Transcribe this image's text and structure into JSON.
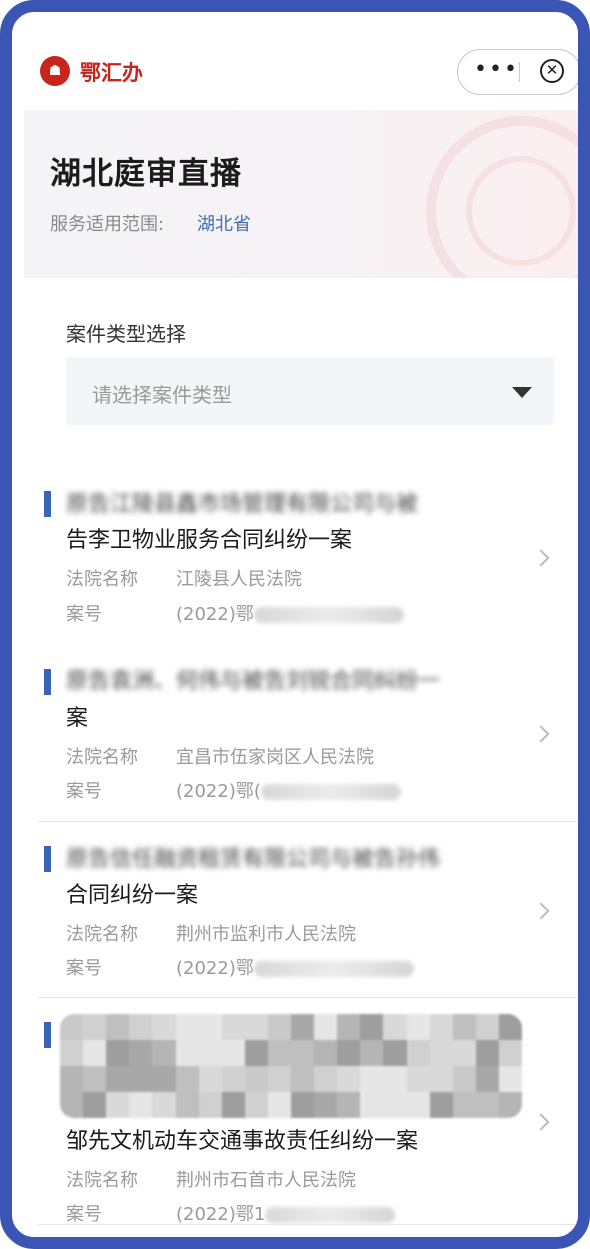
{
  "appbar": {
    "brand": "鄂汇办",
    "logo_glyph": "☗",
    "more_glyph": "•••",
    "close_glyph": "✕"
  },
  "header": {
    "title": "湖北庭审直播",
    "scope_label": "服务适用范围:",
    "scope_value": "湖北省"
  },
  "filter": {
    "label": "案件类型选择",
    "placeholder": "请选择案件类型"
  },
  "cases": [
    {
      "title_line1": "原告江陵县鑫市场管理有限公司与被",
      "title_line2": "告李卫物业服务合同纠纷一案",
      "court_key": "法院名称",
      "court": "江陵县人民法院",
      "case_key": "案号",
      "case_no": "(2022)鄂"
    },
    {
      "title_line1": "原告袁洲、何伟与被告刘锐合同纠纷一",
      "title_line2": "案",
      "court_key": "法院名称",
      "court": "宜昌市伍家岗区人民法院",
      "case_key": "案号",
      "case_no": "(2022)鄂("
    },
    {
      "title_line1": "原告信任融资租赁有限公司与被告孙伟",
      "title_line2": "合同纠纷一案",
      "court_key": "法院名称",
      "court": "荆州市监利市人民法院",
      "case_key": "案号",
      "case_no": "(2022)鄂"
    },
    {
      "title_line2": "邹先文机动车交通事故责任纠纷一案",
      "court_key": "法院名称",
      "court": "荆州市石首市人民法院",
      "case_key": "案号",
      "case_no": "(2022)鄂1"
    }
  ],
  "colors": {
    "brand_red": "#c7241c",
    "accent_blue": "#3b63b5",
    "frame_blue": "#3a55b3",
    "scope_blue": "#3d6fb6"
  }
}
